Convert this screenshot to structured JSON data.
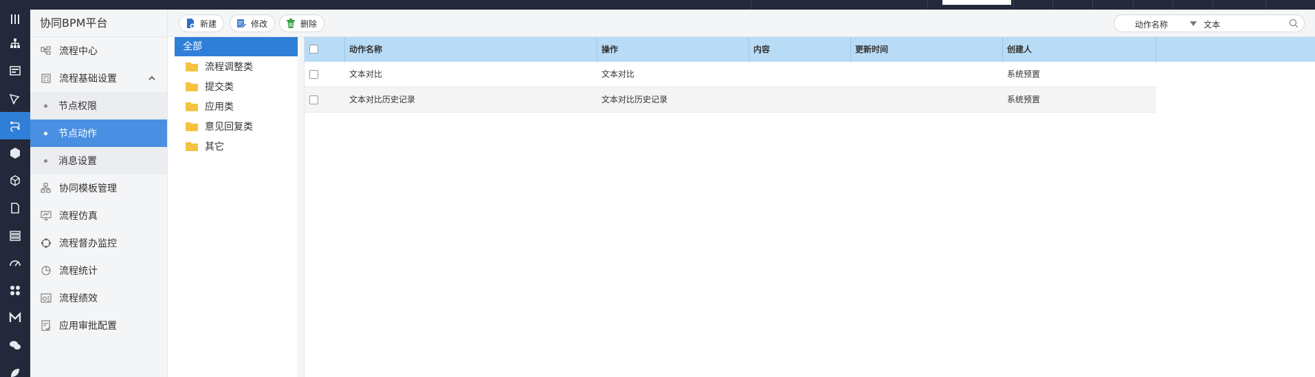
{
  "app": {
    "title": "协同BPM平台"
  },
  "rail_icons": [
    "menu-icon",
    "org-chart-icon",
    "card-icon",
    "pen-icon",
    "flow-icon",
    "hexagon-icon",
    "cube-icon",
    "document-icon",
    "stack-icon",
    "gauge-icon",
    "grid-icon",
    "m-logo-icon",
    "chat-icon",
    "leaf-icon"
  ],
  "nav": {
    "items": [
      {
        "label": "流程中心",
        "icon": "flow-center-icon"
      },
      {
        "label": "流程基础设置",
        "icon": "settings-form-icon",
        "expanded": true,
        "children": [
          {
            "label": "节点权限",
            "active": false
          },
          {
            "label": "节点动作",
            "active": true
          },
          {
            "label": "消息设置",
            "active": false
          }
        ]
      },
      {
        "label": "协同模板管理",
        "icon": "template-icon"
      },
      {
        "label": "流程仿真",
        "icon": "monitor-icon"
      },
      {
        "label": "流程督办监控",
        "icon": "monitor-ring-icon"
      },
      {
        "label": "流程统计",
        "icon": "pie-chart-icon"
      },
      {
        "label": "流程绩效",
        "icon": "performance-icon"
      },
      {
        "label": "应用审批配置",
        "icon": "approval-config-icon"
      }
    ]
  },
  "toolbar": {
    "new_label": "新建",
    "edit_label": "修改",
    "delete_label": "删除",
    "search_field": "动作名称",
    "search_value": "文本"
  },
  "tree": {
    "root": "全部",
    "folders": [
      "流程调整类",
      "提交类",
      "应用类",
      "意见回复类",
      "其它"
    ]
  },
  "table": {
    "columns": [
      "动作名称",
      "操作",
      "内容",
      "更新时间",
      "创建人"
    ],
    "rows": [
      {
        "name": "文本对比",
        "operation": "文本对比",
        "content": "",
        "updated": "",
        "creator": "系统预置"
      },
      {
        "name": "文本对比历史记录",
        "operation": "文本对比历史记录",
        "content": "",
        "updated": "",
        "creator": "系统预置"
      }
    ]
  },
  "colors": {
    "accent": "#2f7fd8",
    "header": "#b8dcf6",
    "rail": "#23283a",
    "folder": "#f5c342"
  }
}
